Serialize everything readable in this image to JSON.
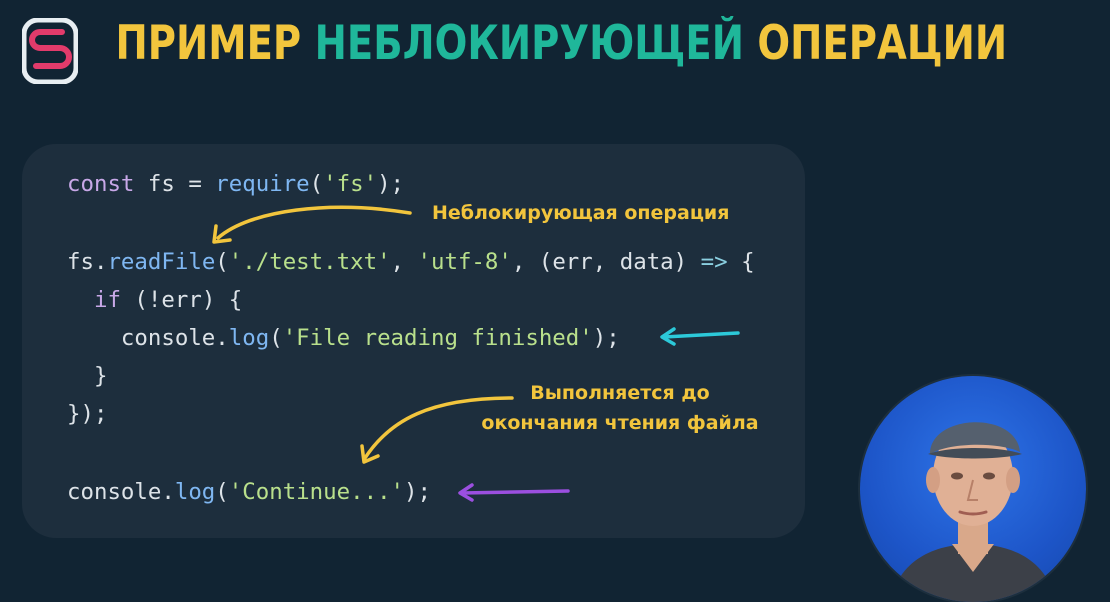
{
  "title": {
    "part1": "ПРИМЕР",
    "part2": "НЕБЛОКИРУЮЩЕЙ",
    "part3": "ОПЕРАЦИИ"
  },
  "code": {
    "line1": {
      "kw": "const",
      "ident": " fs = ",
      "fn": "require",
      "open": "(",
      "str": "'fs'",
      "close": ");"
    },
    "line2": {
      "obj": "fs.",
      "fn": "readFile",
      "open": "(",
      "str1": "'./test.txt'",
      "comma1": ", ",
      "str2": "'utf-8'",
      "rest": ", (err, data) ",
      "arrow": "=>",
      "brace": " {"
    },
    "line3": {
      "indent": "  ",
      "kw": "if",
      "rest": " (!err) {"
    },
    "line4": {
      "indent": "    ",
      "obj": "console.",
      "fn": "log",
      "open": "(",
      "str": "'File reading finished'",
      "close": ");"
    },
    "line5": "  }",
    "line6": "});",
    "line7": {
      "obj": "console.",
      "fn": "log",
      "open": "(",
      "str": "'Continue...'",
      "close": ");"
    }
  },
  "annotations": {
    "nonblocking": "Неблокирующая операция",
    "runs_before_1": "Выполняется до",
    "runs_before_2": "окончания чтения файла"
  },
  "colors": {
    "background": "#112433",
    "panel": "#1D2E3D",
    "title_yellow": "#F2C53D",
    "title_green": "#1FB79A",
    "arrow_yellow": "#F2C53D",
    "arrow_cyan": "#2CC9D9",
    "arrow_purple": "#9B4FE0"
  },
  "icons": {
    "logo": "logo-icon",
    "avatar": "presenter-avatar"
  }
}
